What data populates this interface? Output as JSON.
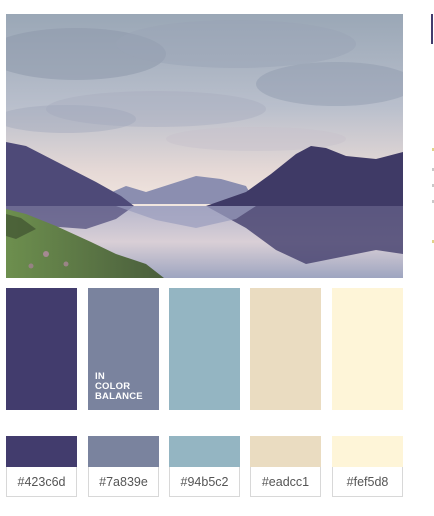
{
  "palette": {
    "brand_lines": [
      "IN",
      "COLOR",
      "BALANCE"
    ],
    "swatches": [
      {
        "hex": "#423c6d",
        "label": "#423c6d"
      },
      {
        "hex": "#7a839e",
        "label": "#7a839e"
      },
      {
        "hex": "#94b5c2",
        "label": "#94b5c2"
      },
      {
        "hex": "#eadcc1",
        "label": "#eadcc1"
      },
      {
        "hex": "#fef5d8",
        "label": "#fef5d8"
      }
    ]
  },
  "colors": {
    "edge_accent": "#423c6d",
    "edge_dots": [
      "#e0d48a",
      "#c9c9c9",
      "#c9c9c9",
      "#c9c9c9",
      "#e0d48a"
    ]
  }
}
